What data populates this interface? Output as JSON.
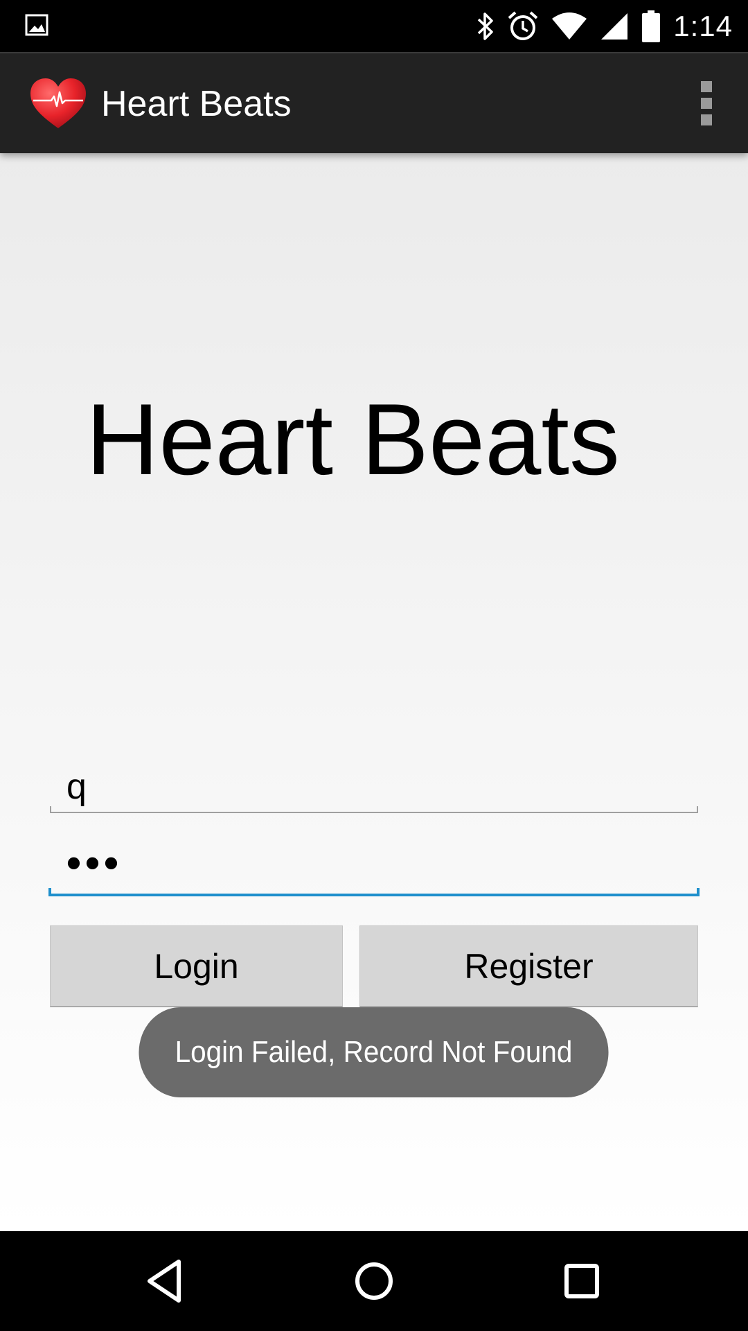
{
  "status_bar": {
    "time": "1:14",
    "icons": [
      "gallery-notification-icon",
      "bluetooth-icon",
      "alarm-icon",
      "wifi-icon",
      "cellular-signal-icon",
      "battery-icon"
    ]
  },
  "action_bar": {
    "title": "Heart Beats",
    "logo_icon": "heart-pulse-icon",
    "overflow_icon": "overflow-menu-icon"
  },
  "main": {
    "headline": "Heart Beats",
    "username_value": "q",
    "password_value": "•••",
    "login_label": "Login",
    "register_label": "Register"
  },
  "toast": {
    "message": "Login Failed, Record Not Found"
  },
  "nav_bar": {
    "icons": [
      "back-icon",
      "home-icon",
      "recents-icon"
    ]
  },
  "colors": {
    "action_bar_bg": "#222222",
    "focus_accent": "#1e8fcc",
    "button_bg": "#d6d6d6",
    "toast_bg": "#6b6b6b",
    "heart_red": "#e8232a"
  }
}
